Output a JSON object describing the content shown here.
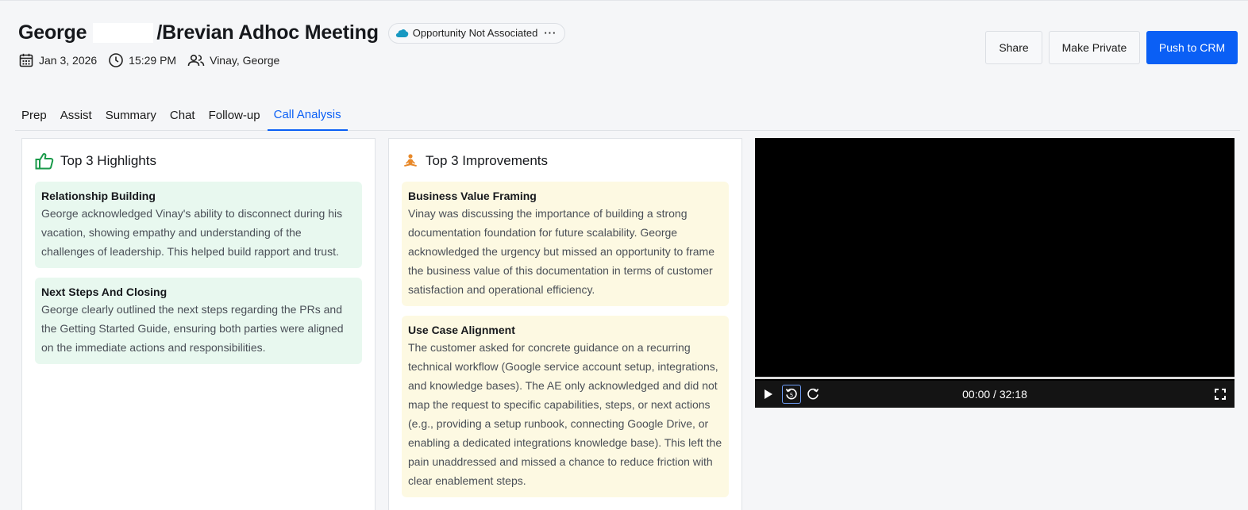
{
  "header": {
    "title_left": "George",
    "title_right": "/Brevian Adhoc Meeting",
    "opportunity_badge": "Opportunity Not Associated",
    "more_glyph": "···",
    "date": "Jan 3, 2026",
    "time": "15:29 PM",
    "participants": "Vinay, George"
  },
  "actions": {
    "share": "Share",
    "make_private": "Make Private",
    "push_to_crm": "Push to CRM"
  },
  "tabs": [
    {
      "label": "Prep"
    },
    {
      "label": "Assist"
    },
    {
      "label": "Summary"
    },
    {
      "label": "Chat"
    },
    {
      "label": "Follow-up"
    },
    {
      "label": "Call Analysis",
      "active": true
    }
  ],
  "highlights": {
    "title": "Top 3 Highlights",
    "items": [
      {
        "title": "Relationship Building",
        "body": "George acknowledged Vinay's ability to disconnect during his vacation, showing empathy and understanding of the challenges of leadership. This helped build rapport and trust."
      },
      {
        "title": "Next Steps And Closing",
        "body": "George clearly outlined the next steps regarding the PRs and the Getting Started Guide, ensuring both parties were aligned on the immediate actions and responsibilities."
      }
    ]
  },
  "improvements": {
    "title": "Top 3 Improvements",
    "items": [
      {
        "title": "Business Value Framing",
        "body": "Vinay was discussing the importance of building a strong documentation foundation for future scalability. George acknowledged the urgency but missed an opportunity to frame the business value of this documentation in terms of customer satisfaction and operational efficiency."
      },
      {
        "title": "Use Case Alignment",
        "body": "The customer asked for concrete guidance on a recurring technical workflow (Google service account setup, integrations, and knowledge bases). The AE only acknowledged and did not map the request to specific capabilities, steps, or next actions (e.g., providing a setup runbook, connecting Google Drive, or enabling a dedicated integrations knowledge base). This left the pain unaddressed and missed a chance to reduce friction with clear enablement steps."
      }
    ]
  },
  "video": {
    "time_display": "00:00 / 32:18"
  },
  "colors": {
    "accent": "#0a5ff5",
    "highlight_bg": "#e8f8ef",
    "improvement_bg": "#fdf9e2",
    "thumbs_up": "#1a9a4a",
    "improve_icon": "#e8892a"
  }
}
